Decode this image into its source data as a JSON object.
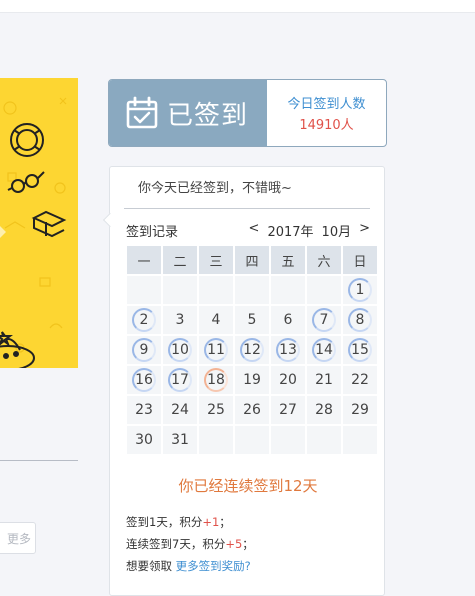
{
  "signin": {
    "button_label": "已签到",
    "count_title": "今日签到人数",
    "count_value": "14910人"
  },
  "panel": {
    "message": "你今天已经签到，不错哦~",
    "record_label": "签到记录",
    "prev_arrow": "<",
    "next_arrow": ">",
    "year": "2017年",
    "month": "10月",
    "weekdays": [
      "一",
      "二",
      "三",
      "四",
      "五",
      "六",
      "日"
    ],
    "leading_blanks": 6,
    "days_in_month": 31,
    "signed_days": [
      1,
      2,
      7,
      8,
      9,
      10,
      11,
      12,
      13,
      14,
      15,
      16,
      17
    ],
    "today": 18,
    "streak_text": "你已经连续签到12天",
    "rule1_prefix": "签到1天，积分",
    "rule1_plus": "+1",
    "rule1_suffix": "；",
    "rule2_prefix": "连续签到7天，积分",
    "rule2_plus": "+5",
    "rule2_suffix": "；",
    "rule3_prefix": "想要领取 ",
    "rule3_link": "更多签到奖励?"
  },
  "left": {
    "more_button": "更多"
  },
  "colors": {
    "signin_bg": "#8aa9c0",
    "count_title": "#3f8fd1",
    "count_value": "#e0524a",
    "streak": "#e0793e",
    "banner": "#fdd632"
  }
}
